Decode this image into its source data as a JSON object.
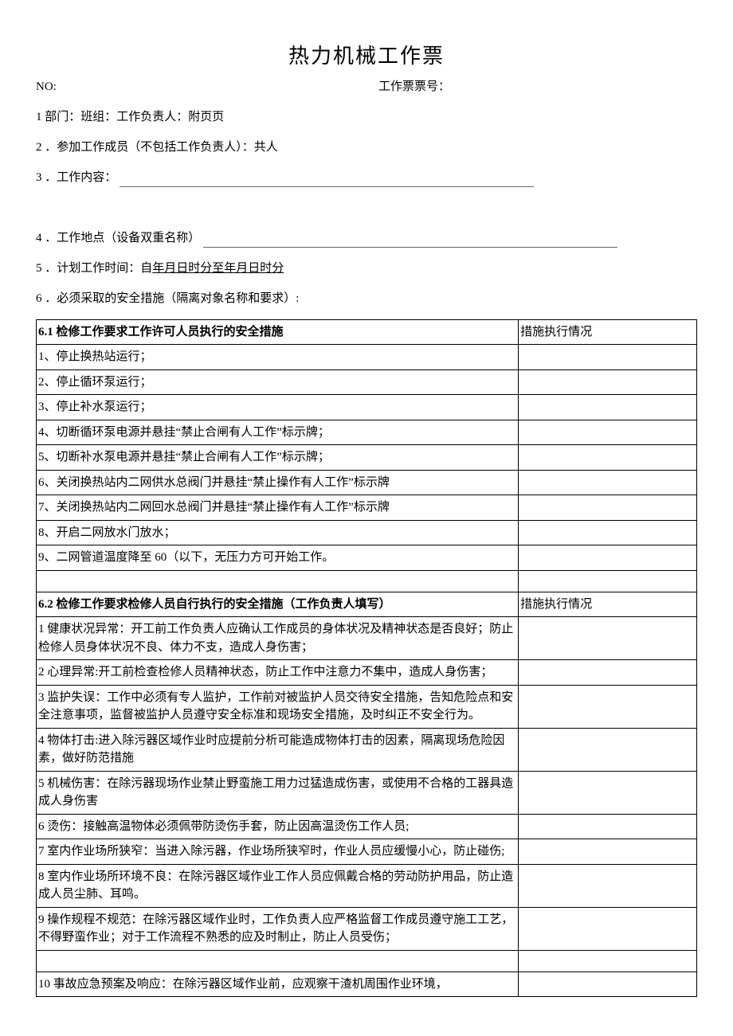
{
  "title": "热力机械工作票",
  "header": {
    "no_label": "NO:",
    "ticket_no_label": "工作票票号："
  },
  "fields": {
    "f1": "1 部门：班组：工作负责人：附页页",
    "f2": "2 ．参加工作成员（不包括工作负责人）：共人",
    "f3_label": "3 ．工作内容：",
    "f4_label": "4 ．工作地点（设备双重名称）",
    "f5_label": "5 ．计划工作时间：自",
    "f5_value": "年月日时分至年月日时分",
    "f6": "6 ．必须采取的安全措施（隔离对象名称和要求）:"
  },
  "table": {
    "sec61_header": "6.1 检修工作要求工作许可人员执行的安全措施",
    "status_header": "措施执行情况",
    "sec61_rows": [
      "1、停止换热站运行；",
      "2、停止循环泵运行；",
      "3、停止补水泵运行；",
      "4、切断循环泵电源并悬挂“禁止合闸有人工作”标示牌；",
      "5、切断补水泵电源并悬挂“禁止合闸有人工作”标示牌；",
      "6、关闭换热站内二网供水总阀门并悬挂“禁止操作有人工作”标示牌",
      "7、关闭换热站内二网回水总阀门并悬挂“禁止操作有人工作”标示牌",
      "8、开启二网放水门放水；",
      "9、二网管道温度降至 60（以下，无压力方可开始工作。"
    ],
    "sec62_header": "6.2 检修工作要求检修人员自行执行的安全措施（工作负责人填写）",
    "sec62_rows": [
      "1 健康状况异常：开工前工作负责人应确认工作成员的身体状况及精神状态是否良好；防止检修人员身体状况不良、体力不支，造成人身伤害；",
      "2 心理异常:开工前检查检修人员精神状态，防止工作中注意力不集中，造成人身伤害；",
      "3 监护失误：工作中必须有专人监护，工作前对被监护人员交待安全措施，告知危险点和安全注意事项，监督被监护人员遵守安全标准和现场安全措施，及时纠正不安全行为。",
      "4 物体打击:进入除污器区域作业时应提前分析可能造成物体打击的因素，隔离现场危险因素，做好防范措施",
      "5 机械伤害：在除污器现场作业禁止野蛮施工用力过猛造成伤害，或使用不合格的工器具造成人身伤害",
      "6 烫伤：接触高温物体必须佩带防烫伤手套，防止因高温烫伤工作人员;",
      "7 室内作业场所狭窄：当进入除污器，作业场所狭窄时，作业人员应缓慢小心，防止碰伤;",
      "8 室内作业场所环境不良：在除污器区域作业工作人员应佩戴合格的劳动防护用品，防止造成人员尘肺、耳鸣。",
      "9 操作规程不规范：在除污器区域作业时，工作负责人应严格监督工作成员遵守施工工艺，不得野蛮作业；对于工作流程不熟悉的应及时制止，防止人员受伤；",
      "10 事故应急预案及响应：在除污器区域作业前，应观察干渣机周围作业环境，"
    ]
  }
}
